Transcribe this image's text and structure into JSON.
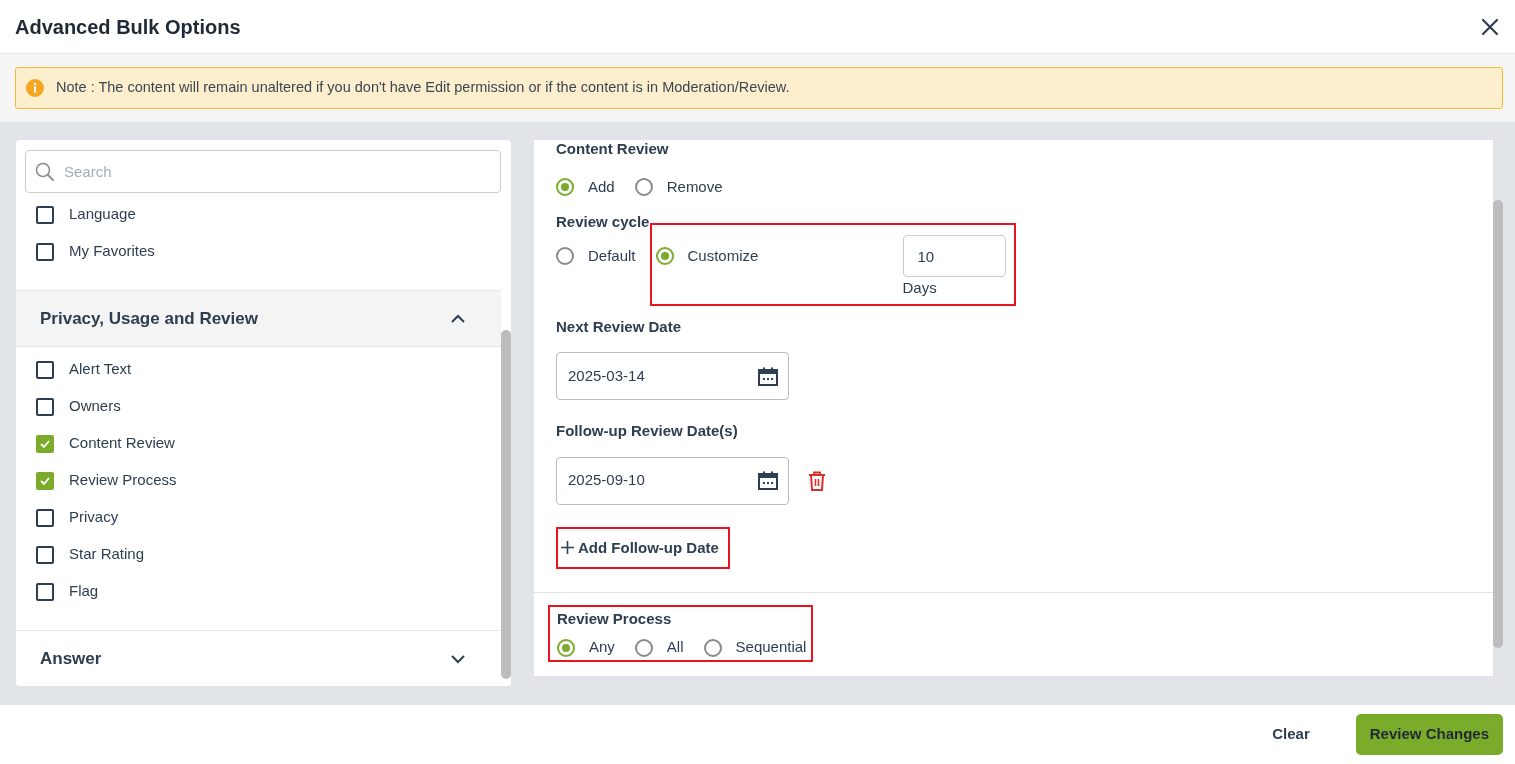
{
  "dialog": {
    "title": "Advanced Bulk Options"
  },
  "note": "Note : The content will remain unaltered if you don't have Edit permission or if the content is in Moderation/Review.",
  "sidebar": {
    "search": {
      "placeholder": "Search"
    },
    "top_items": [
      {
        "label": "Language",
        "checked": false
      },
      {
        "label": "My Favorites",
        "checked": false
      }
    ],
    "sections": [
      {
        "title": "Privacy, Usage and Review",
        "expanded": true,
        "items": [
          {
            "label": "Alert Text",
            "checked": false
          },
          {
            "label": "Owners",
            "checked": false
          },
          {
            "label": "Content Review",
            "checked": true
          },
          {
            "label": "Review Process",
            "checked": true
          },
          {
            "label": "Privacy",
            "checked": false
          },
          {
            "label": "Star Rating",
            "checked": false
          },
          {
            "label": "Flag",
            "checked": false
          }
        ]
      },
      {
        "title": "Answer",
        "expanded": false
      }
    ]
  },
  "content_review": {
    "title": "Content Review",
    "options": [
      {
        "label": "Add",
        "selected": true
      },
      {
        "label": "Remove",
        "selected": false
      }
    ]
  },
  "review_cycle": {
    "title": "Review cycle",
    "options": [
      {
        "label": "Default",
        "selected": false,
        "highlighted": false
      },
      {
        "label": "Customize",
        "selected": true,
        "highlighted": true
      }
    ],
    "days_value": "10",
    "days_unit": "Days"
  },
  "next_review_date": {
    "label": "Next Review Date",
    "value": "2025-03-14"
  },
  "follow_up": {
    "label": "Follow-up Review Date(s)",
    "dates": [
      {
        "value": "2025-09-10"
      }
    ],
    "add_label": "Add Follow-up Date",
    "highlighted": true
  },
  "review_process": {
    "title": "Review Process",
    "highlighted": true,
    "options": [
      {
        "label": "Any",
        "selected": true
      },
      {
        "label": "All",
        "selected": false
      },
      {
        "label": "Sequential",
        "selected": false
      }
    ]
  },
  "footer": {
    "buttons": [
      {
        "label": "Clear",
        "kind": "link"
      },
      {
        "label": "Review Changes",
        "kind": "primary"
      }
    ]
  }
}
